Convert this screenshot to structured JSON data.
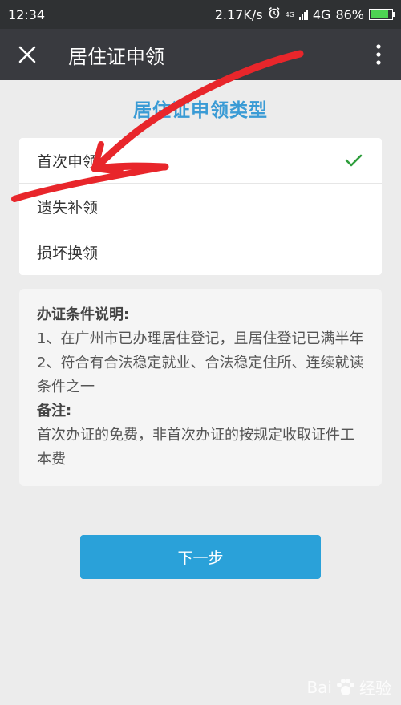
{
  "status_bar": {
    "time": "12:34",
    "net_speed": "2.17K/s",
    "network_small": "4G",
    "network": "4G",
    "battery": "86%",
    "battery_level": 0.86,
    "icons": [
      "alarm-icon",
      "signal-icon",
      "battery-icon"
    ]
  },
  "nav": {
    "title": "居住证申领",
    "close_icon": "close-icon",
    "more_icon": "more-vertical-icon"
  },
  "section_title": "居住证申领类型",
  "options": [
    {
      "label": "首次申领",
      "selected": true
    },
    {
      "label": "遗失补领",
      "selected": false
    },
    {
      "label": "损坏换领",
      "selected": false
    }
  ],
  "info": {
    "heading": "办证条件说明:",
    "lines": [
      "1、在广州市已办理居住登记，且居住登记已满半年",
      "2、符合有合法稳定就业、合法稳定住所、连续就读条件之一"
    ],
    "note_heading": "备注:",
    "note": "首次办证的免费，非首次办证的按规定收取证件工本费"
  },
  "next_button": "下一步",
  "watermark": {
    "brand_a": "Bai",
    "brand_b": "经验"
  },
  "colors": {
    "accent": "#2aa1d9",
    "title": "#3a9bd5",
    "check": "#2e9e3c",
    "arrow": "#e8262b"
  }
}
